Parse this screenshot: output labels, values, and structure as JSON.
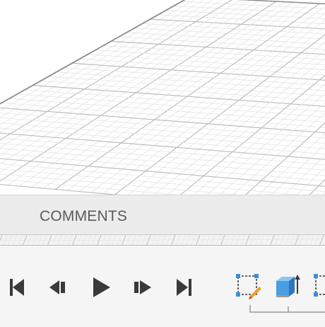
{
  "panels": {
    "comments": {
      "label": "COMMENTS"
    }
  },
  "timeline": {
    "controls": [
      {
        "name": "go-to-start",
        "icon": "skip-to-start-icon"
      },
      {
        "name": "step-back",
        "icon": "step-back-icon"
      },
      {
        "name": "play",
        "icon": "play-icon"
      },
      {
        "name": "step-forward",
        "icon": "step-forward-icon"
      },
      {
        "name": "go-to-end",
        "icon": "skip-to-end-icon"
      }
    ],
    "features": [
      {
        "name": "sketch",
        "icon": "sketch-edit-icon"
      },
      {
        "name": "extrude",
        "icon": "extrude-icon"
      },
      {
        "name": "sketch",
        "icon": "sketch-icon"
      }
    ]
  },
  "colors": {
    "grid_major": "#bdbdbd",
    "grid_minor": "#e4e4e4",
    "grid_edge": "#8c8c8c",
    "panel_bg": "#ececec",
    "timeline_bg": "#f5f5f5",
    "icon_dark": "#3a3a3a",
    "accent_blue": "#3b8fd9",
    "accent_orange": "#f0a030"
  }
}
